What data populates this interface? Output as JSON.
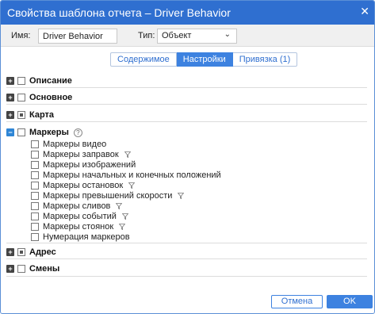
{
  "window": {
    "title": "Свойства шаблона отчета – Driver Behavior",
    "close_glyph": "✕"
  },
  "namebar": {
    "name_label": "Имя:",
    "name_value": "Driver Behavior",
    "type_label": "Тип:",
    "type_value": "Объект"
  },
  "tabs": [
    {
      "label": "Содержимое",
      "active": false
    },
    {
      "label": "Настройки",
      "active": true
    },
    {
      "label": "Привязка (1)",
      "active": false
    }
  ],
  "sections": [
    {
      "label": "Описание",
      "expanded": false,
      "check": "none"
    },
    {
      "label": "Основное",
      "expanded": false,
      "check": "none"
    },
    {
      "label": "Карта",
      "expanded": false,
      "check": "partial"
    },
    {
      "label": "Маркеры",
      "expanded": true,
      "check": "none",
      "help": "?",
      "items": [
        {
          "label": "Маркеры видео",
          "filter": false
        },
        {
          "label": "Маркеры заправок",
          "filter": true
        },
        {
          "label": "Маркеры изображений",
          "filter": false
        },
        {
          "label": "Маркеры начальных и конечных положений",
          "filter": false
        },
        {
          "label": "Маркеры остановок",
          "filter": true
        },
        {
          "label": "Маркеры превышений скорости",
          "filter": true
        },
        {
          "label": "Маркеры сливов",
          "filter": true
        },
        {
          "label": "Маркеры событий",
          "filter": true
        },
        {
          "label": "Маркеры стоянок",
          "filter": true
        },
        {
          "label": "Нумерация маркеров",
          "filter": false
        }
      ]
    },
    {
      "label": "Адрес",
      "expanded": false,
      "check": "partial"
    },
    {
      "label": "Смены",
      "expanded": false,
      "check": "none"
    }
  ],
  "footer": {
    "cancel_label": "Отмена",
    "ok_label": "OK"
  },
  "colors": {
    "accent": "#2f6fd0",
    "active_tab": "#3d82e0"
  }
}
